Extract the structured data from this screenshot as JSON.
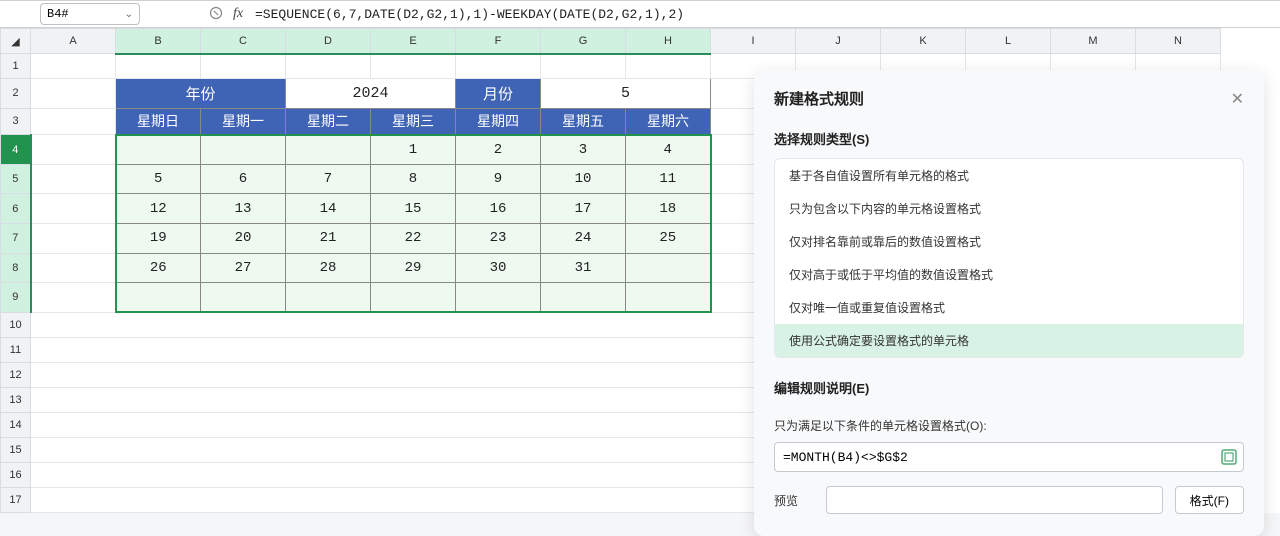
{
  "formula_bar": {
    "cell_ref": "B4#",
    "formula": "=SEQUENCE(6,7,DATE(D2,G2,1),1)-WEEKDAY(DATE(D2,G2,1),2)"
  },
  "columns": [
    "A",
    "B",
    "C",
    "D",
    "E",
    "F",
    "G",
    "H",
    "I",
    "J",
    "K",
    "L",
    "M",
    "N"
  ],
  "rows": [
    "1",
    "2",
    "3",
    "4",
    "5",
    "6",
    "7",
    "8",
    "9",
    "10",
    "11",
    "12",
    "13",
    "14",
    "15",
    "16",
    "17"
  ],
  "calendar": {
    "year_label": "年份",
    "month_label": "月份",
    "year": "2024",
    "month": "5",
    "weekdays": [
      "星期日",
      "星期一",
      "星期二",
      "星期三",
      "星期四",
      "星期五",
      "星期六"
    ],
    "grid": [
      [
        "",
        "",
        "",
        "1",
        "2",
        "3",
        "4"
      ],
      [
        "5",
        "6",
        "7",
        "8",
        "9",
        "10",
        "11"
      ],
      [
        "12",
        "13",
        "14",
        "15",
        "16",
        "17",
        "18"
      ],
      [
        "19",
        "20",
        "21",
        "22",
        "23",
        "24",
        "25"
      ],
      [
        "26",
        "27",
        "28",
        "29",
        "30",
        "31",
        ""
      ],
      [
        "",
        "",
        "",
        "",
        "",
        "",
        ""
      ]
    ]
  },
  "panel": {
    "title": "新建格式规则",
    "section_type": "选择规则类型(S)",
    "rule_types": [
      "基于各自值设置所有单元格的格式",
      "只为包含以下内容的单元格设置格式",
      "仅对排名靠前或靠后的数值设置格式",
      "仅对高于或低于平均值的数值设置格式",
      "仅对唯一值或重复值设置格式",
      "使用公式确定要设置格式的单元格"
    ],
    "section_edit": "编辑规则说明(E)",
    "condition_label": "只为满足以下条件的单元格设置格式(O):",
    "formula": "=MONTH(B4)<>$G$2",
    "preview_label": "预览",
    "format_btn": "格式(F)"
  }
}
